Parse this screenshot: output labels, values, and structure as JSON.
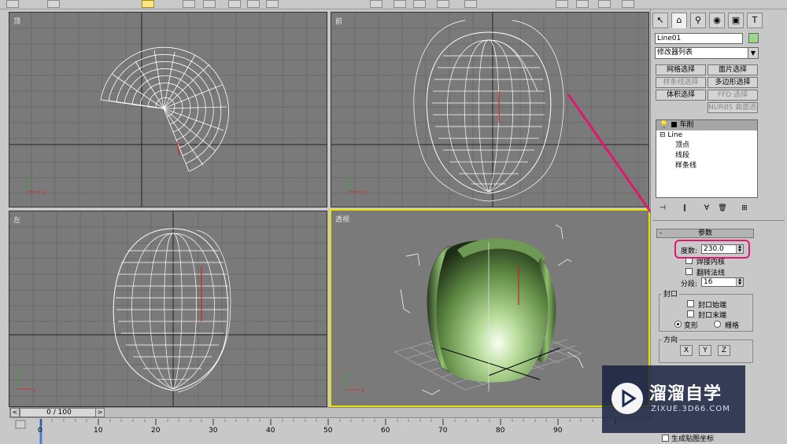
{
  "viewports": {
    "top": {
      "label": "顶"
    },
    "front": {
      "label": "前"
    },
    "left": {
      "label": "左"
    },
    "perspective": {
      "label": "透视"
    }
  },
  "panel": {
    "object_name": "Line01",
    "object_color": "#9bd68a",
    "modifier_list": "修改器列表",
    "buttons": [
      {
        "label": "网格选择",
        "enabled": true
      },
      {
        "label": "面片选择",
        "enabled": true
      },
      {
        "label": "样条线选择",
        "enabled": false
      },
      {
        "label": "多边形选择",
        "enabled": true
      },
      {
        "label": "体积选择",
        "enabled": true
      },
      {
        "label": "FFD 选择",
        "enabled": false
      },
      {
        "label": "NURBS 曲面选择",
        "enabled": false
      }
    ],
    "stack": {
      "lathe": "车削",
      "line": "Line",
      "sub_items": [
        "顶点",
        "线段",
        "样条线"
      ]
    },
    "params": {
      "title": "参数",
      "degrees_label": "度数:",
      "degrees_value": "230.0",
      "weld_core": "焊接内核",
      "flip_normals": "翻转法线",
      "segments_label": "分段:",
      "segments_value": "16",
      "cap_group": "封口",
      "cap_start": "封口始端",
      "cap_end": "封口末端",
      "morph": "变形",
      "grid": "栅格",
      "direction_group": "方向",
      "x": "X",
      "y": "Y",
      "z": "Z",
      "gen_mapping": "生成贴图坐标"
    },
    "highlight_color": "#e0186c"
  },
  "timeline": {
    "frame_display": "0 / 100",
    "ticks": [
      "0",
      "10",
      "20",
      "30",
      "40",
      "50",
      "60",
      "70",
      "80",
      "90"
    ]
  },
  "watermark": {
    "title": "溜溜自学",
    "subtitle": "ZIXUE.3D66.COM"
  }
}
